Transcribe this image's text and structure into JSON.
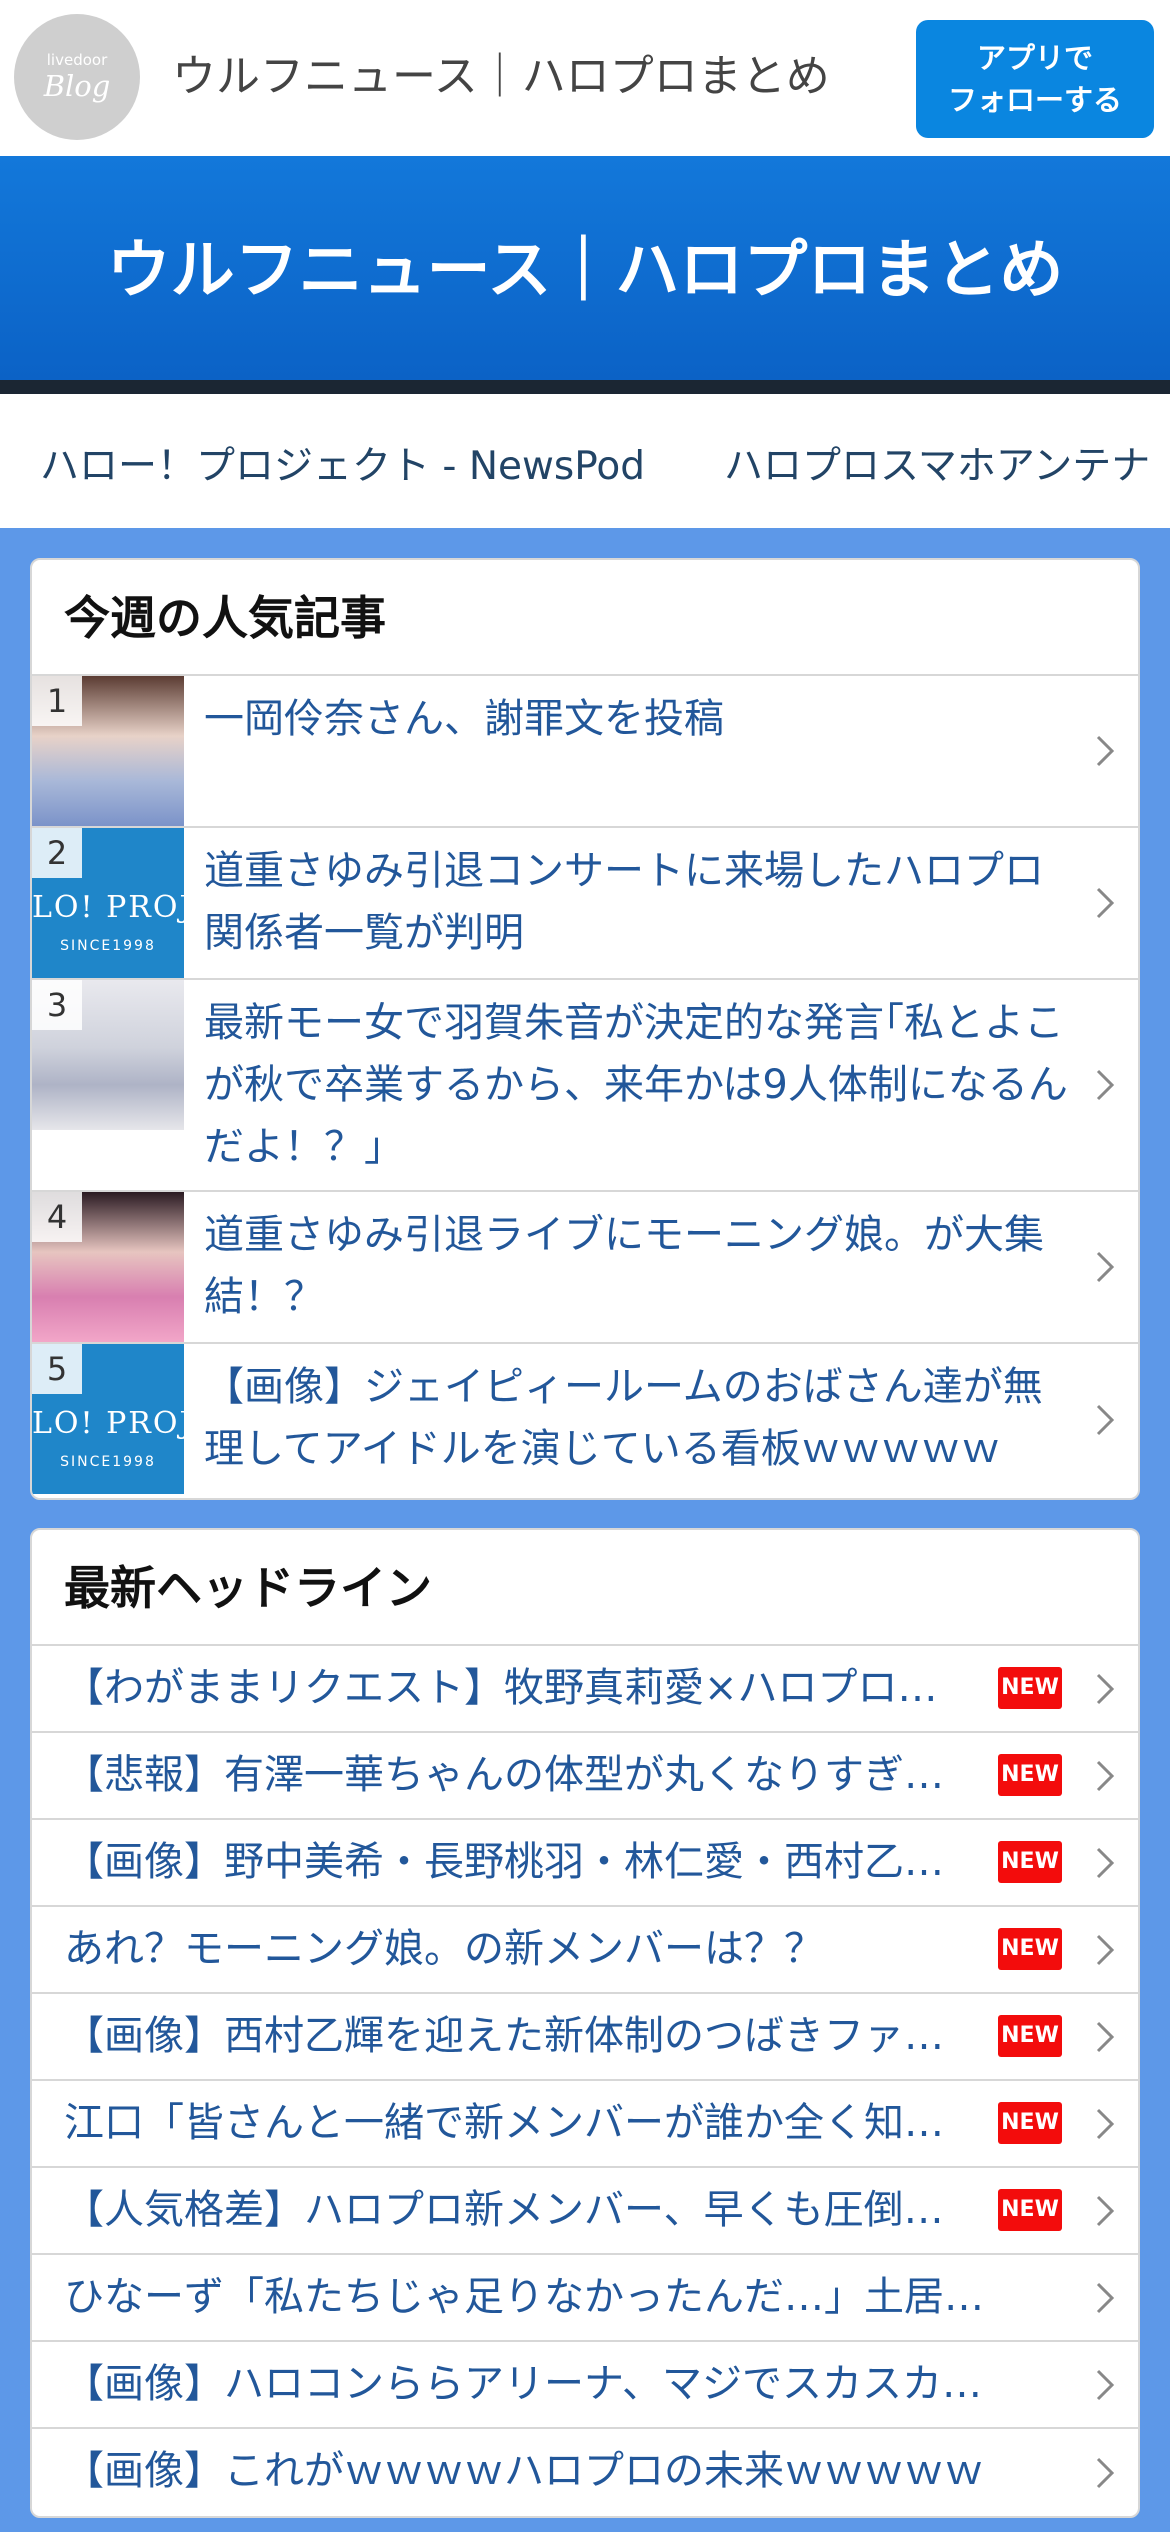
{
  "logo": {
    "small": "livedoor",
    "big": "Blog"
  },
  "site_name": "ウルフニュース｜ハロプロまとめ",
  "follow_button": "アプリで\nフォローする",
  "hero_title": "ウルフニュース｜ハロプロまとめ",
  "nav_links": [
    "ハロー！プロジェクト - NewsPod",
    "ハロプロスマホアンテナ"
  ],
  "ranking": {
    "title": "今週の人気記事",
    "items": [
      {
        "rank": "1",
        "thumb": "photo",
        "text": "一岡伶奈さん、謝罪文を投稿"
      },
      {
        "rank": "2",
        "thumb": "hello-project-logo",
        "thumb_text": "LO! PROJ",
        "thumb_sub": "SINCE1998",
        "text": "道重さゆみ引退コンサートに来場したハロプロ関係者一覧が判明"
      },
      {
        "rank": "3",
        "thumb": "group-photo",
        "text": "最新モー女で羽賀朱音が決定的な発言｢私とよこが秋で卒業するから、来年かは9人体制になるんだよ！？｣"
      },
      {
        "rank": "4",
        "thumb": "photo",
        "text": "道重さゆみ引退ライブにモーニング娘。が大集結！？"
      },
      {
        "rank": "5",
        "thumb": "hello-project-logo",
        "thumb_text": "LO! PROJ",
        "thumb_sub": "SINCE1998",
        "text": "【画像】ジェイピィールームのおばさん達が無理してアイドルを演じている看板ｗｗｗｗｗ"
      }
    ]
  },
  "headlines": {
    "title": "最新ヘッドライン",
    "new_label": "NEW",
    "items": [
      {
        "text": "【わがままリクエスト】牧野真莉愛×ハロプロ…",
        "new": true
      },
      {
        "text": "【悲報】有澤一華ちゃんの体型が丸くなりすぎ…",
        "new": true
      },
      {
        "text": "【画像】野中美希・長野桃羽・林仁愛・西村乙…",
        "new": true
      },
      {
        "text": "あれ？モーニング娘。の新メンバーは？？",
        "new": true
      },
      {
        "text": "【画像】西村乙輝を迎えた新体制のつばきファ…",
        "new": true
      },
      {
        "text": "江口「皆さんと一緒で新メンバーが誰か全く知…",
        "new": true
      },
      {
        "text": "【人気格差】ハロプロ新メンバー、早くも圧倒…",
        "new": true
      },
      {
        "text": "ひなーず「私たちじゃ足りなかったんだ…」土居…",
        "new": false
      },
      {
        "text": "【画像】ハロコンららアリーナ、マジでスカスカ…",
        "new": false
      },
      {
        "text": "【画像】これがｗｗｗｗハロプロの未来ｗｗｗｗｗ",
        "new": false
      }
    ]
  },
  "colors": {
    "accent": "#0a86e0",
    "hero": "#1171d6",
    "page_bg": "#5d98e8",
    "link_text": "#22579a",
    "new_badge": "#f30c0c"
  }
}
